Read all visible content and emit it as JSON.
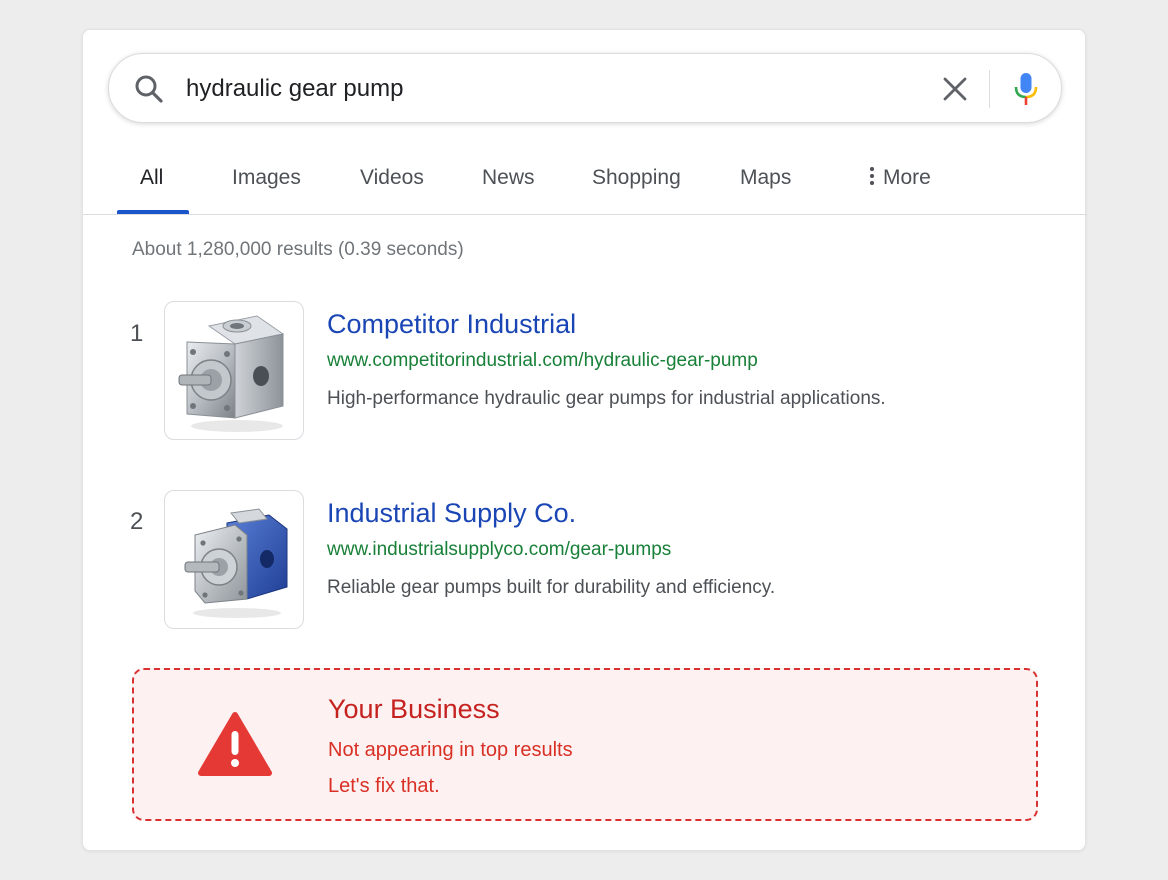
{
  "search": {
    "query": "hydraulic gear pump"
  },
  "tabs": [
    {
      "label": "All",
      "active": true
    },
    {
      "label": "Images"
    },
    {
      "label": "Videos"
    },
    {
      "label": "News"
    },
    {
      "label": "Shopping"
    },
    {
      "label": "Maps"
    },
    {
      "label": "More"
    }
  ],
  "result_stats": "About 1,280,000 results (0.39 seconds)",
  "results": [
    {
      "rank": "1",
      "title": "Competitor Industrial",
      "url": "www.competitorindustrial.com/hydraulic-gear-pump",
      "snippet": "High-performance hydraulic gear pumps for industrial applications.",
      "thumbnail_icon": "silver-gear-pump-image"
    },
    {
      "rank": "2",
      "title": "Industrial Supply Co.",
      "url": "www.industrialsupplyco.com/gear-pumps",
      "snippet": "Reliable gear pumps built for durability and efficiency.",
      "thumbnail_icon": "blue-gear-pump-image"
    }
  ],
  "callout": {
    "icon": "warning-triangle-icon",
    "title": "Your Business",
    "line1": "Not appearing in top results",
    "line2": "Let's fix that."
  },
  "colors": {
    "link_blue": "#1a46b5",
    "url_green": "#188038",
    "tab_accent": "#1a56c9",
    "alert_red": "#d93131",
    "alert_bg": "#fdf1f1"
  }
}
